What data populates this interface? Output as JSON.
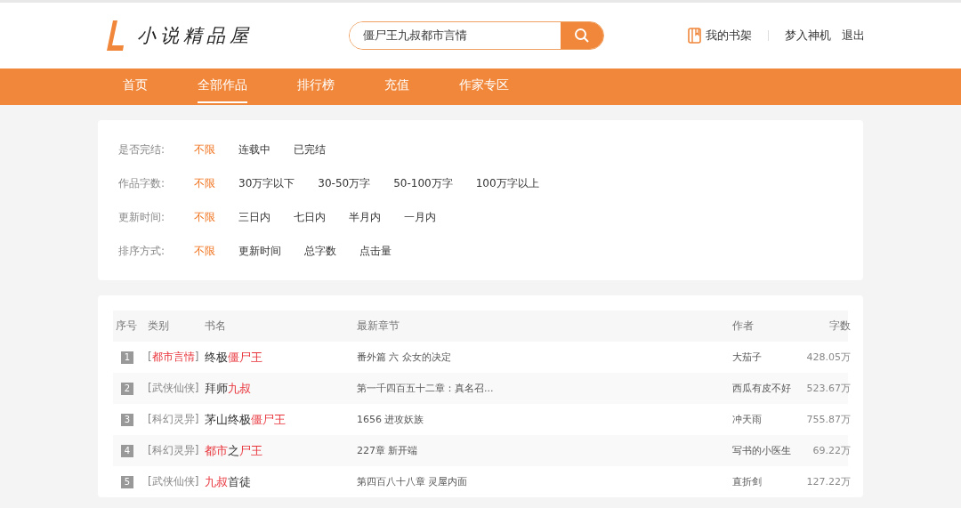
{
  "logo": {
    "text": "小说精品屋"
  },
  "search": {
    "value": "僵尸王九叔都市言情"
  },
  "user_links": {
    "bookshelf": "我的书架",
    "username": "梦入神机",
    "logout": "退出"
  },
  "nav": [
    {
      "label": "首页",
      "selected": false
    },
    {
      "label": "全部作品",
      "selected": true
    },
    {
      "label": "排行榜",
      "selected": false
    },
    {
      "label": "充值",
      "selected": false
    },
    {
      "label": "作家专区",
      "selected": false
    }
  ],
  "filters": [
    {
      "label": "是否完结:",
      "options": [
        {
          "label": "不限",
          "selected": true
        },
        {
          "label": "连载中",
          "selected": false
        },
        {
          "label": "已完结",
          "selected": false
        }
      ]
    },
    {
      "label": "作品字数:",
      "options": [
        {
          "label": "不限",
          "selected": true
        },
        {
          "label": "30万字以下",
          "selected": false
        },
        {
          "label": "30-50万字",
          "selected": false
        },
        {
          "label": "50-100万字",
          "selected": false
        },
        {
          "label": "100万字以上",
          "selected": false
        }
      ]
    },
    {
      "label": "更新时间:",
      "options": [
        {
          "label": "不限",
          "selected": true
        },
        {
          "label": "三日内",
          "selected": false
        },
        {
          "label": "七日内",
          "selected": false
        },
        {
          "label": "半月内",
          "selected": false
        },
        {
          "label": "一月内",
          "selected": false
        }
      ]
    },
    {
      "label": "排序方式:",
      "options": [
        {
          "label": "不限",
          "selected": true
        },
        {
          "label": "更新时间",
          "selected": false
        },
        {
          "label": "总字数",
          "selected": false
        },
        {
          "label": "点击量",
          "selected": false
        }
      ]
    }
  ],
  "table": {
    "columns": [
      "序号",
      "类别",
      "书名",
      "最新章节",
      "作者",
      "字数"
    ],
    "rows": [
      {
        "rank": "1",
        "category": [
          {
            "text": "[",
            "highlight": false
          },
          {
            "text": "都市言情",
            "highlight": true
          },
          {
            "text": "]",
            "highlight": false
          }
        ],
        "title": [
          {
            "text": "终极",
            "highlight": false
          },
          {
            "text": "僵尸王",
            "highlight": true
          }
        ],
        "chapter": "番外篇 六 众女的决定",
        "author": "大茄子",
        "words": "428.05万"
      },
      {
        "rank": "2",
        "category": [
          {
            "text": "[武侠仙侠]",
            "highlight": false
          }
        ],
        "title": [
          {
            "text": "拜师",
            "highlight": false
          },
          {
            "text": "九叔",
            "highlight": true
          }
        ],
        "chapter": "第一千四百五十二章：真名召...",
        "author": "西瓜有皮不好",
        "words": "523.67万"
      },
      {
        "rank": "3",
        "category": [
          {
            "text": "[科幻灵异]",
            "highlight": false
          }
        ],
        "title": [
          {
            "text": "茅山终极",
            "highlight": false
          },
          {
            "text": "僵尸王",
            "highlight": true
          }
        ],
        "chapter": "1656 进攻妖族",
        "author": "冲天雨",
        "words": "755.87万"
      },
      {
        "rank": "4",
        "category": [
          {
            "text": "[科幻灵异]",
            "highlight": false
          }
        ],
        "title": [
          {
            "text": "都市",
            "highlight": true
          },
          {
            "text": "之",
            "highlight": false
          },
          {
            "text": "尸王",
            "highlight": true
          }
        ],
        "chapter": "227章 新开端",
        "author": "写书的小医生",
        "words": "69.22万"
      },
      {
        "rank": "5",
        "category": [
          {
            "text": "[武侠仙侠]",
            "highlight": false
          }
        ],
        "title": [
          {
            "text": "九叔",
            "highlight": true
          },
          {
            "text": "首徒",
            "highlight": false
          }
        ],
        "chapter": "第四百八十八章 灵屋内面",
        "author": "直折剑",
        "words": "127.22万"
      }
    ]
  }
}
